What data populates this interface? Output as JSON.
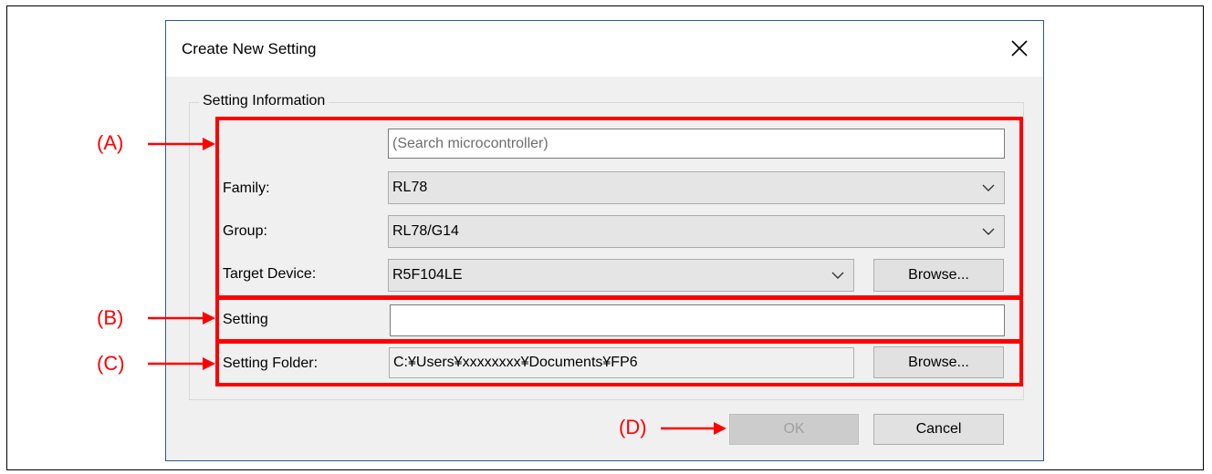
{
  "window": {
    "title": "Create New Setting",
    "close_icon": "close-icon"
  },
  "setting_info": {
    "group_label": "Setting Information",
    "search_placeholder": "(Search microcontroller)",
    "family_label": "Family:",
    "family_value": "RL78",
    "group_field_label": "Group:",
    "group_value": "RL78/G14",
    "target_device_label": "Target Device:",
    "target_device_value": "R5F104LE",
    "browse_label": "Browse...",
    "setting_label": "Setting",
    "setting_value": "",
    "setting_folder_label": "Setting Folder:",
    "setting_folder_value": "C:¥Users¥xxxxxxxx¥Documents¥FP6",
    "folder_browse_label": "Browse..."
  },
  "buttons": {
    "ok_label": "OK",
    "ok_enabled": false,
    "cancel_label": "Cancel"
  },
  "annotations": {
    "a": "(A)",
    "b": "(B)",
    "c": "(C)",
    "d": "(D)",
    "color": "#ff0000"
  },
  "colors": {
    "dialog_border": "#2b579a",
    "highlight": "#ff0000",
    "dialog_bg": "#f0f0f0"
  }
}
